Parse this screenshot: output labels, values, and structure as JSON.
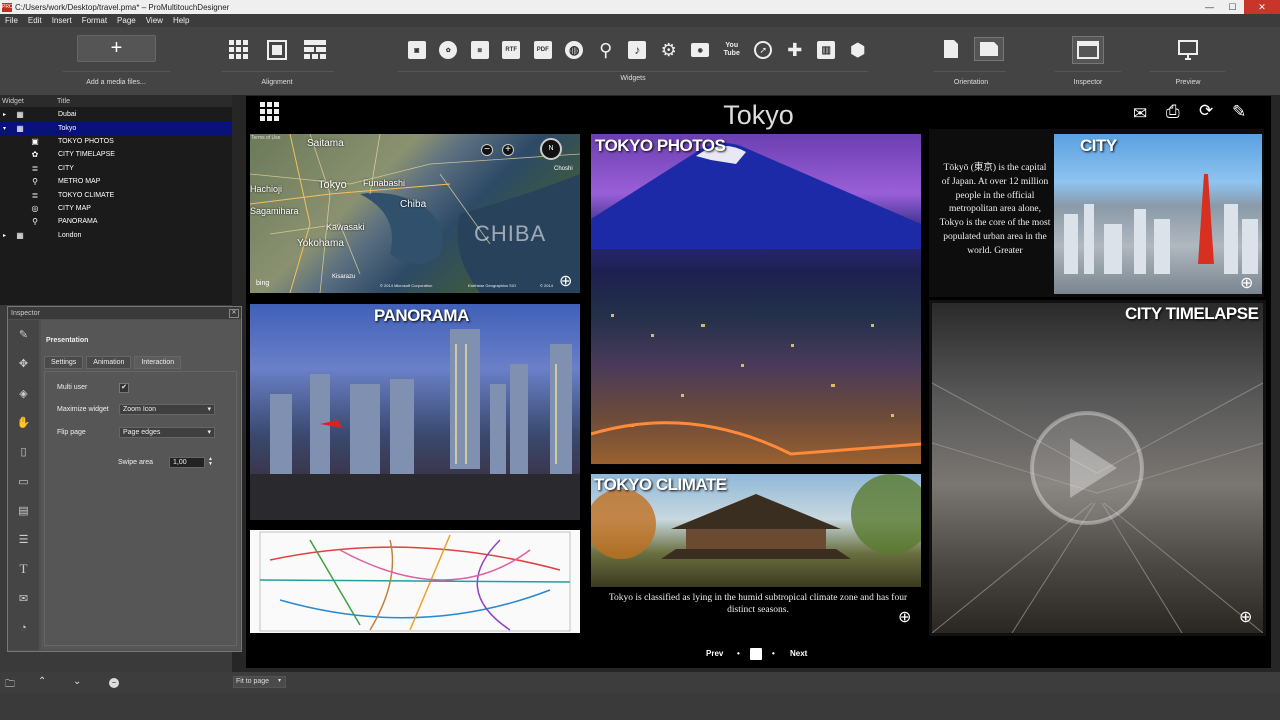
{
  "window": {
    "title": "C:/Users/work/Desktop/travel.pma* – ProMultitouchDesigner",
    "app_icon": "PRO"
  },
  "menu": [
    "File",
    "Edit",
    "Insert",
    "Format",
    "Page",
    "View",
    "Help"
  ],
  "toolbar": {
    "add_media_label": "Add a media files...",
    "alignment_label": "Alignment",
    "widgets_label": "Widgets",
    "orientation_label": "Orientation",
    "inspector_label": "Inspector",
    "preview_label": "Preview",
    "widget_icons": [
      "image-icon",
      "reel-icon",
      "text-icon",
      "RTF",
      "PDF",
      "globe-icon",
      "pin-icon",
      "music-icon",
      "gear-icon",
      "camera-icon",
      "You Tube",
      "compass-icon",
      "puzzle-icon",
      "chart-icon",
      "cube-icon"
    ]
  },
  "tree": {
    "col_widget": "Widget",
    "col_title": "Title",
    "rows": [
      {
        "title": "Dubai",
        "icon": "grid-icon",
        "level": 0,
        "expander": "▸"
      },
      {
        "title": "Tokyo",
        "icon": "grid-icon",
        "level": 0,
        "expander": "▾",
        "selected": true
      },
      {
        "title": "TOKYO PHOTOS",
        "icon": "image-icon",
        "level": 1
      },
      {
        "title": "CITY TIMELAPSE",
        "icon": "reel-icon",
        "level": 1
      },
      {
        "title": "CITY",
        "icon": "text-icon",
        "level": 1
      },
      {
        "title": "METRO MAP",
        "icon": "pin-icon",
        "level": 1
      },
      {
        "title": "TOKYO CLIMATE",
        "icon": "text-icon",
        "level": 1
      },
      {
        "title": "CITY MAP",
        "icon": "compass-icon",
        "level": 1
      },
      {
        "title": "PANORAMA",
        "icon": "pin-icon",
        "level": 1
      },
      {
        "title": "London",
        "icon": "grid-icon",
        "level": 0,
        "expander": "▸"
      }
    ]
  },
  "inspector": {
    "title": "Inspector",
    "section": "Presentation",
    "tabs": [
      "Settings",
      "Animation",
      "Interaction"
    ],
    "active_tab": "Interaction",
    "multi_user_label": "Multi user",
    "multi_user_checked": "✔",
    "maximize_label": "Maximize widget",
    "maximize_value": "Zoom Icon",
    "flip_label": "Flip page",
    "flip_value": "Page edges",
    "swipe_label": "Swipe area",
    "swipe_value": "1,00"
  },
  "status": {
    "zoom_value": "Fit to page"
  },
  "page": {
    "title": "Tokyo",
    "tiles": {
      "map": {
        "attrib_left": "© 2014 Microsoft Corporation",
        "attrib_mid": "Earthstar Geographics SIO",
        "attrib_right": "© 2014",
        "bing": "bing",
        "terms": "Terms of Use",
        "city_labels": [
          "Saitama",
          "Tokyo",
          "Funabashi",
          "Chiba",
          "Kawasaki",
          "Yokohama",
          "Sagamihara",
          "Hachioji",
          "CHIBA",
          "Kisarazu",
          "Choshi"
        ]
      },
      "photos": {
        "label": "TOKYO PHOTOS"
      },
      "city": {
        "label": "CITY",
        "text": "Tōkyō (東京) is the capital of Japan. At over 12 million people in the official metropolitan area alone, Tokyo is the core of the most populated urban area in the world. Greater"
      },
      "panorama": {
        "label": "PANORAMA"
      },
      "timelapse": {
        "label": "CITY TIMELAPSE"
      },
      "climate": {
        "label": "TOKYO CLIMATE",
        "text": "Tokyo is classified as lying in the humid subtropical climate zone and has four distinct seasons."
      }
    },
    "nav": {
      "prev": "Prev",
      "next": "Next"
    }
  }
}
